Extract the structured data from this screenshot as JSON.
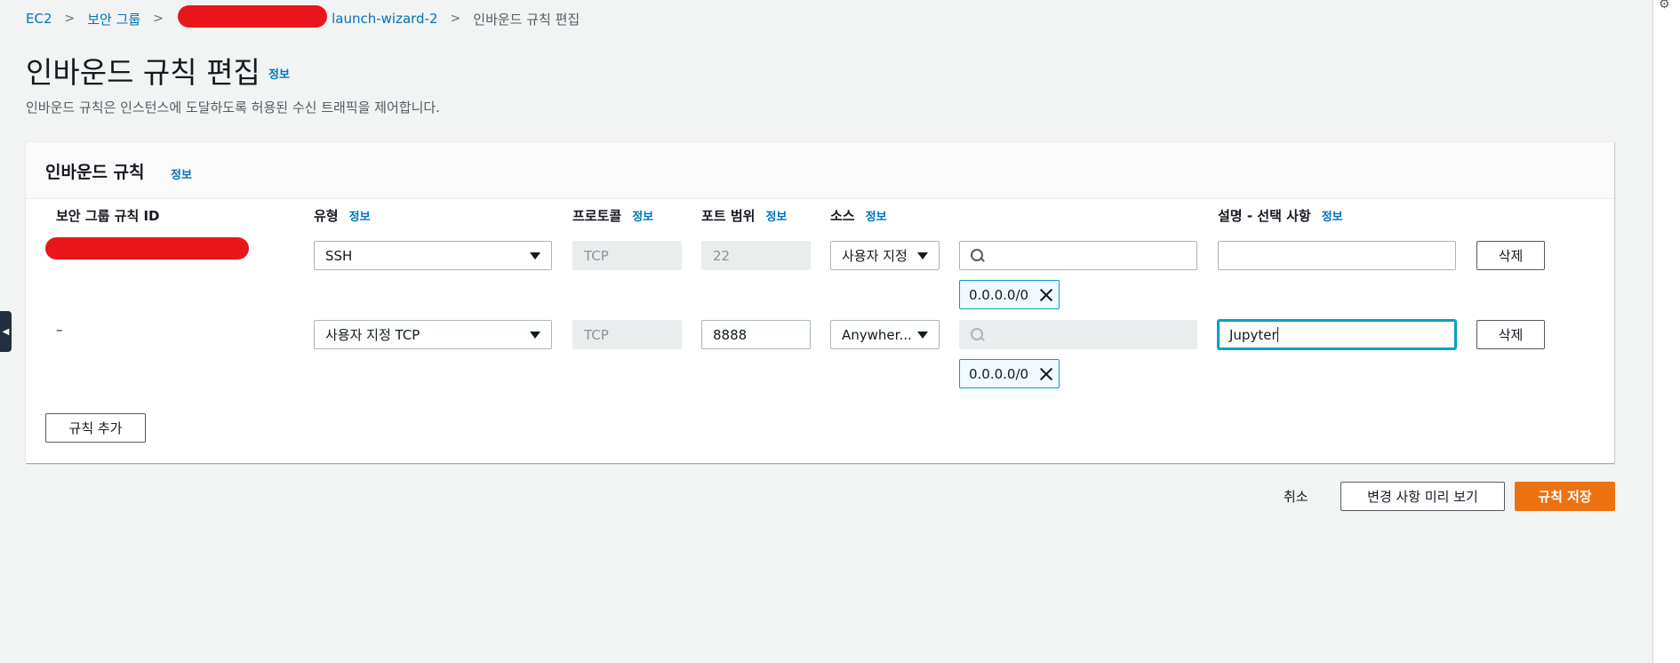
{
  "breadcrumb": {
    "items": [
      "EC2",
      "보안 그룹",
      "- launch-wizard-2"
    ],
    "current": "인바운드 규칙 편집",
    "separator": ">"
  },
  "page": {
    "title": "인바운드 규칙 편집",
    "info": "정보",
    "description": "인바운드 규칙은 인스턴스에 도달하도록 허용된 수신 트래픽을 제어합니다."
  },
  "panel": {
    "title": "인바운드 규칙",
    "info": "정보",
    "columns": {
      "rule_id": "보안 그룹 규칙 ID",
      "type": "유형",
      "protocol": "프로토콜",
      "port_range": "포트 범위",
      "source": "소스",
      "description": "설명 - 선택 사항",
      "info": "정보"
    },
    "rules": [
      {
        "rule_id": "",
        "type": "SSH",
        "protocol": "TCP",
        "port_range": "22",
        "source_type": "사용자 지정",
        "source_search": "",
        "cidr": "0.0.0.0/0",
        "description": "",
        "delete_label": "삭제"
      },
      {
        "rule_id": "–",
        "type": "사용자 지정 TCP",
        "protocol": "TCP",
        "port_range": "8888",
        "source_type": "Anywher...",
        "source_search": "",
        "cidr": "0.0.0.0/0",
        "description": "Jupyter",
        "delete_label": "삭제"
      }
    ],
    "add_rule_label": "규칙 추가"
  },
  "footer": {
    "cancel_label": "취소",
    "preview_label": "변경 사항 미리 보기",
    "save_label": "규칙 저장"
  },
  "colors": {
    "accent": "#ec7211",
    "link": "#0073bb",
    "focus": "#00a1c9",
    "redaction": "#e8161b"
  }
}
